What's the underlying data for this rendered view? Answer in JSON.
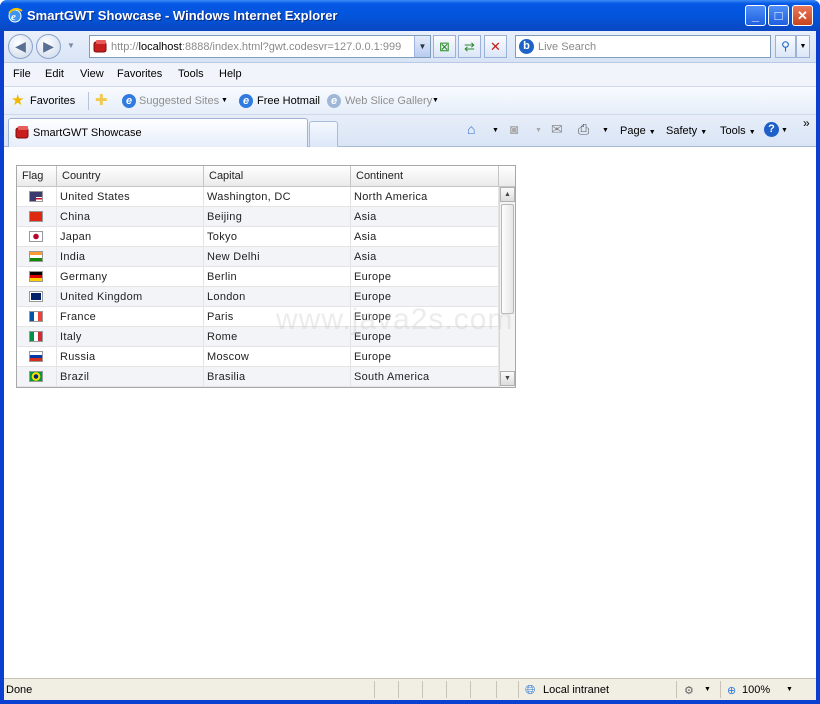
{
  "window": {
    "title": "SmartGWT Showcase - Windows Internet Explorer",
    "minimize": "_",
    "maximize": "□",
    "close": "✕"
  },
  "address_bar": {
    "url_prefix": "http://",
    "url_host": "localhost",
    "url_rest": ":8888/index.html?gwt.codesvr=127.0.0.1:999",
    "search_placeholder": "Live Search"
  },
  "menu": [
    "File",
    "Edit",
    "View",
    "Favorites",
    "Tools",
    "Help"
  ],
  "favorites_bar": {
    "favorites": "Favorites",
    "suggested_sites": "Suggested Sites",
    "free_hotmail": "Free Hotmail",
    "web_slice_gallery": "Web Slice Gallery"
  },
  "tab": {
    "label": "SmartGWT Showcase"
  },
  "command_bar": {
    "page": "Page",
    "safety": "Safety",
    "tools": "Tools",
    "overflow": "»"
  },
  "watermark": "www.java2s.com",
  "grid": {
    "columns": [
      "Flag",
      "Country",
      "Capital",
      "Continent"
    ],
    "rows": [
      {
        "flag": "us-flag",
        "country": "United States",
        "capital": "Washington, DC",
        "continent": "North America"
      },
      {
        "flag": "cn-flag",
        "country": "China",
        "capital": "Beijing",
        "continent": "Asia"
      },
      {
        "flag": "jp-flag",
        "country": "Japan",
        "capital": "Tokyo",
        "continent": "Asia"
      },
      {
        "flag": "in-flag",
        "country": "India",
        "capital": "New Delhi",
        "continent": "Asia"
      },
      {
        "flag": "de-flag",
        "country": "Germany",
        "capital": "Berlin",
        "continent": "Europe"
      },
      {
        "flag": "gb-flag",
        "country": "United Kingdom",
        "capital": "London",
        "continent": "Europe"
      },
      {
        "flag": "fr-flag",
        "country": "France",
        "capital": "Paris",
        "continent": "Europe"
      },
      {
        "flag": "it-flag",
        "country": "Italy",
        "capital": "Rome",
        "continent": "Europe"
      },
      {
        "flag": "ru-flag",
        "country": "Russia",
        "capital": "Moscow",
        "continent": "Europe"
      },
      {
        "flag": "br-flag",
        "country": "Brazil",
        "capital": "Brasilia",
        "continent": "South America"
      }
    ]
  },
  "status_bar": {
    "status": "Done",
    "zone": "Local intranet",
    "zoom": "100%"
  },
  "colors": {
    "titlebar": "#0453d8",
    "accent": "#1e64c8"
  }
}
